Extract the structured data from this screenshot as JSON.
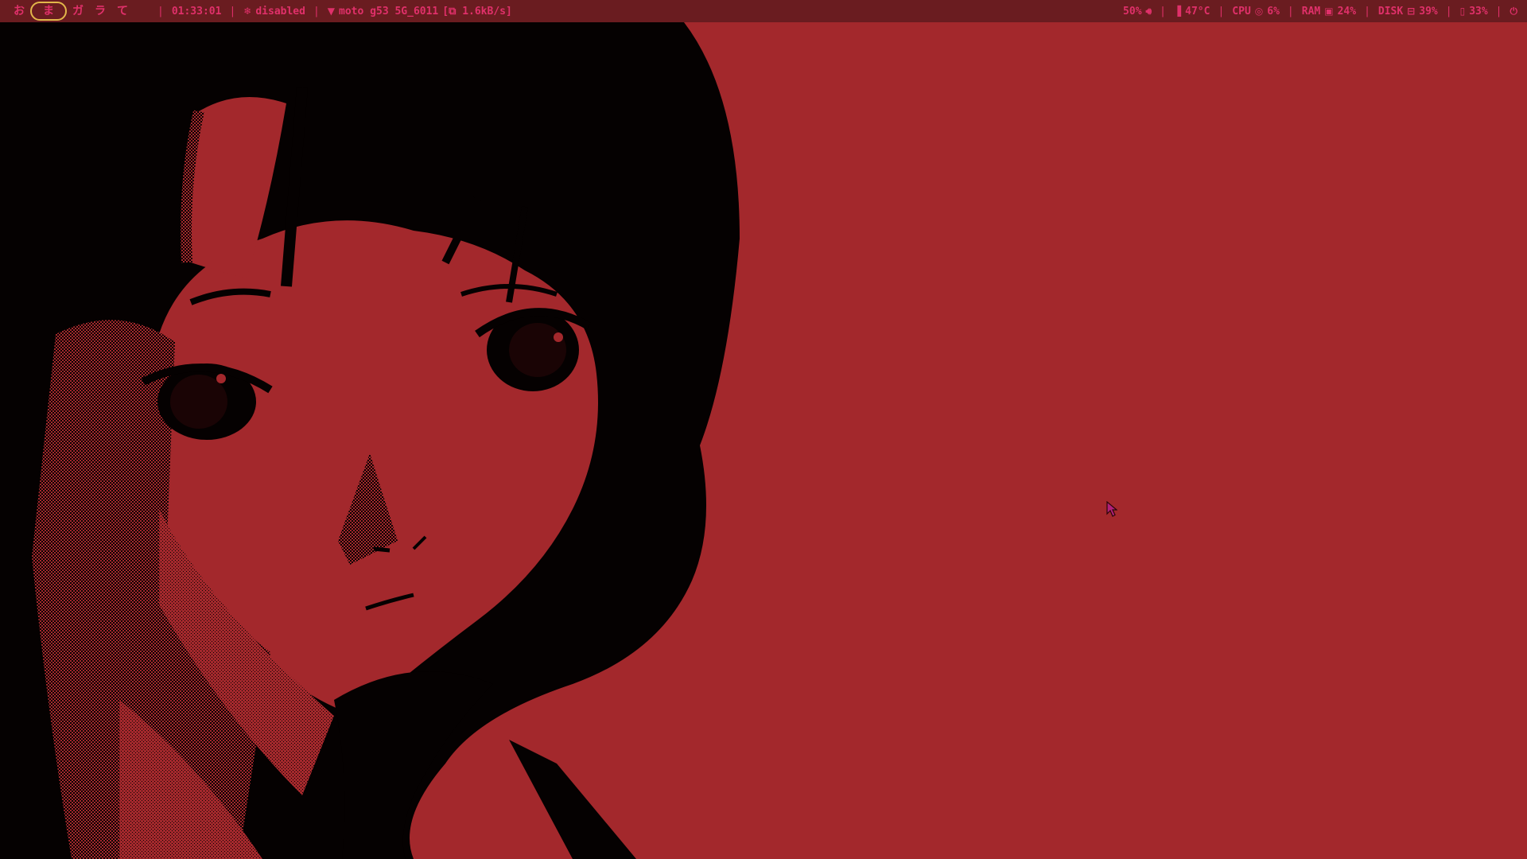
{
  "workspaces": [
    "お",
    "ま",
    "ガ",
    "ラ",
    "て"
  ],
  "active_workspace_index": 1,
  "clock": "01:33:01",
  "bluetooth": {
    "icon": "bluetooth-icon",
    "label": "disabled"
  },
  "network": {
    "icon": "wifi-icon",
    "ssid": "moto g53 5G_6011",
    "speed": "[⧉ 1.6kB/s]"
  },
  "volume": {
    "value": "50%",
    "icon": "speaker-icon"
  },
  "temperature": {
    "icon": "thermometer-icon",
    "value": "47°C"
  },
  "cpu": {
    "label": "CPU",
    "icon": "cpu-icon",
    "value": "6%"
  },
  "ram": {
    "label": "RAM",
    "icon": "memory-icon",
    "value": "24%"
  },
  "disk": {
    "label": "DISK",
    "icon": "disk-icon",
    "value": "39%"
  },
  "battery": {
    "icon": "battery-icon",
    "value": "33%"
  },
  "power": {
    "icon": "power-icon"
  },
  "colors": {
    "bar_bg": "#6a1c20",
    "bar_fg": "#e0306a",
    "active_ring": "#e2b64a",
    "wallpaper_red": "#a3282c",
    "wallpaper_dark": "#050101"
  }
}
